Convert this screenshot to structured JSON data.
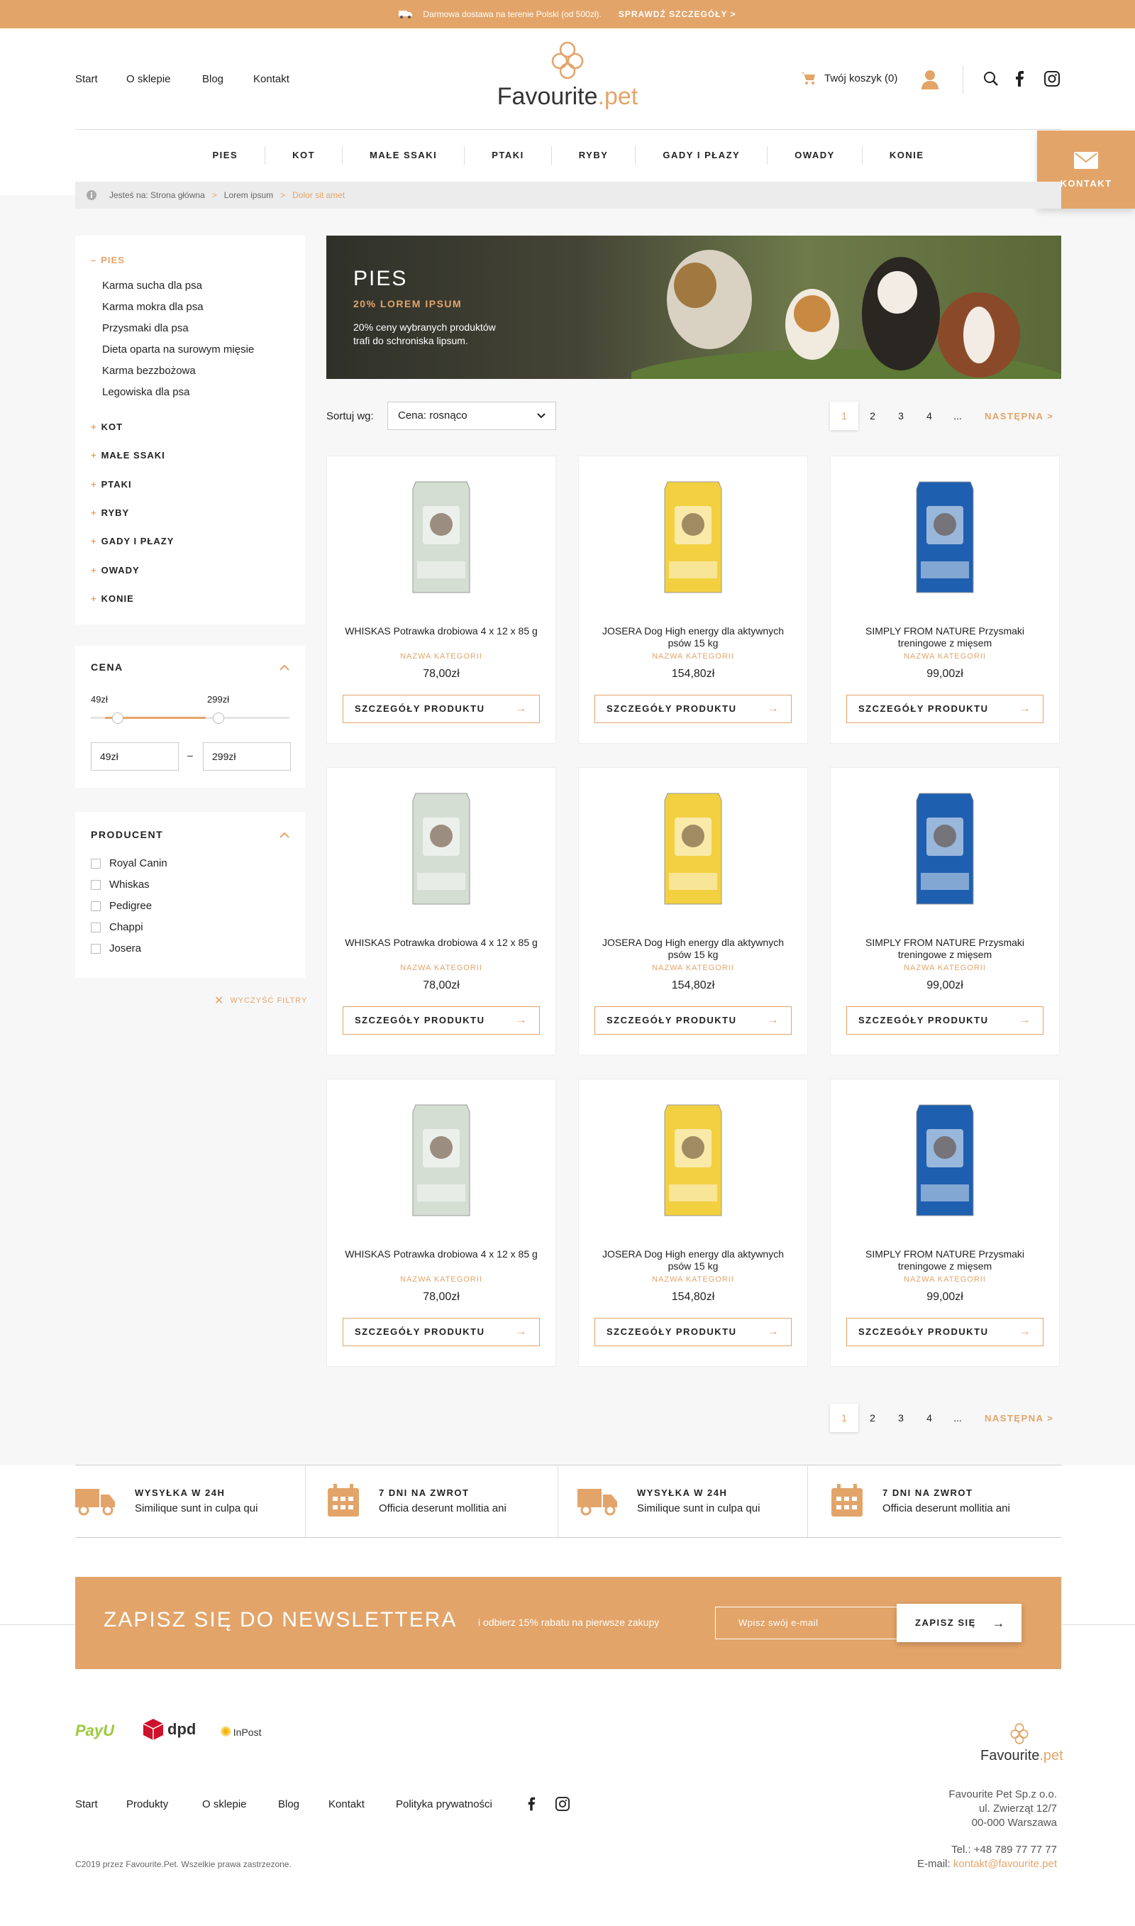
{
  "topbar": {
    "text": "Darmowa dostawa na terenie Polski (od 500zł).",
    "link": "SPRAWDŹ SZCZEGÓŁY >"
  },
  "header": {
    "nav": [
      "Start",
      "O sklepie",
      "Blog",
      "Kontakt"
    ],
    "logo_main": "Favourite",
    "logo_ext": ".pet",
    "cart": "Twój koszyk (0)",
    "contact": "KONTAKT"
  },
  "categories": [
    "PIES",
    "KOT",
    "MAŁE SSAKI",
    "PTAKI",
    "RYBY",
    "GADY I PŁAZY",
    "OWADY",
    "KONIE"
  ],
  "breadcrumb": {
    "prefix": "Jesteś na: Strona główna",
    "item1": "Lorem ipsum",
    "item2": "Dolor sit amet",
    "sep": ">"
  },
  "sidebar": {
    "active_cat": "PIES",
    "minus": "–",
    "plus": "+",
    "subcats": [
      "Karma sucha dla psa",
      "Karma mokra dla psa",
      "Przysmaki dla psa",
      "Dieta oparta na surowym mięsie",
      "Karma bezzbożowa",
      "Legowiska dla psa"
    ],
    "other_cats": [
      "KOT",
      "MAŁE SSAKI",
      "PTAKI",
      "RYBY",
      "GADY I PŁAZY",
      "OWADY",
      "KONIE"
    ],
    "price": {
      "title": "CENA",
      "min": "49zł",
      "max": "299zł",
      "min_input": "49zł",
      "max_input": "299zł",
      "dash": "–"
    },
    "producer": {
      "title": "PRODUCENT",
      "items": [
        "Royal Canin",
        "Whiskas",
        "Pedigree",
        "Chappi",
        "Josera"
      ]
    },
    "clear": "WYCZYŚĆ FILTRY"
  },
  "banner": {
    "title": "PIES",
    "subtitle": "20% LOREM IPSUM",
    "desc": "20% ceny wybranych produktów trafi do schroniska lipsum."
  },
  "sort": {
    "label": "Sortuj wg:",
    "value": "Cena: rosnąco"
  },
  "pagination": {
    "pages": [
      "1",
      "2",
      "3",
      "4",
      "..."
    ],
    "active": "1",
    "next": "NASTĘPNA >"
  },
  "products": [
    {
      "name": "WHISKAS Potrawka drobiowa 4 x 12 x 85 g",
      "category": "NAZWA KATEGORII",
      "price": "78,00zł",
      "button": "SZCZEGÓŁY PRODUKTU",
      "pack": "NATUREPLUS+",
      "pack_color": "#d4ded2"
    },
    {
      "name": "JOSERA Dog High energy dla aktywnych psów 15 kg",
      "category": "NAZWA KATEGORII",
      "price": "154,80zł",
      "button": "SZCZEGÓŁY PRODUKTU",
      "pack": "Josera",
      "pack_color": "#f2d040"
    },
    {
      "name": "SIMPLY FROM NATURE Przysmaki treningowe z mięsem",
      "category": "NAZWA KATEGORII",
      "price": "99,00zł",
      "button": "SZCZEGÓŁY PRODUKTU",
      "pack": "Chappi",
      "pack_color": "#1e5fb0"
    },
    {
      "name": "WHISKAS Potrawka drobiowa 4 x 12 x 85 g",
      "category": "NAZWA KATEGORII",
      "price": "78,00zł",
      "button": "SZCZEGÓŁY PRODUKTU",
      "pack": "NATUREPLUS+",
      "pack_color": "#d4ded2"
    },
    {
      "name": "JOSERA Dog High energy dla aktywnych psów 15 kg",
      "category": "NAZWA KATEGORII",
      "price": "154,80zł",
      "button": "SZCZEGÓŁY PRODUKTU",
      "pack": "Josera",
      "pack_color": "#f2d040"
    },
    {
      "name": "SIMPLY FROM NATURE Przysmaki treningowe z mięsem",
      "category": "NAZWA KATEGORII",
      "price": "99,00zł",
      "button": "SZCZEGÓŁY PRODUKTU",
      "pack": "Chappi",
      "pack_color": "#1e5fb0"
    },
    {
      "name": "WHISKAS Potrawka drobiowa 4 x 12 x 85 g",
      "category": "NAZWA KATEGORII",
      "price": "78,00zł",
      "button": "SZCZEGÓŁY PRODUKTU",
      "pack": "NATUREPLUS+",
      "pack_color": "#d4ded2"
    },
    {
      "name": "JOSERA Dog High energy dla aktywnych psów 15 kg",
      "category": "NAZWA KATEGORII",
      "price": "154,80zł",
      "button": "SZCZEGÓŁY PRODUKTU",
      "pack": "Josera",
      "pack_color": "#f2d040"
    },
    {
      "name": "SIMPLY FROM NATURE Przysmaki treningowe z mięsem",
      "category": "NAZWA KATEGORII",
      "price": "99,00zł",
      "button": "SZCZEGÓŁY PRODUKTU",
      "pack": "Chappi",
      "pack_color": "#1e5fb0"
    }
  ],
  "features": [
    {
      "icon": "truck-icon",
      "title": "WYSYŁKA W 24H",
      "text": "Similique sunt in culpa qui"
    },
    {
      "icon": "calendar-icon",
      "title": "7 DNI NA ZWROT",
      "text": "Officia deserunt mollitia ani"
    },
    {
      "icon": "truck-icon",
      "title": "WYSYŁKA W 24H",
      "text": "Similique sunt in culpa qui"
    },
    {
      "icon": "calendar-icon",
      "title": "7 DNI NA ZWROT",
      "text": "Officia deserunt mollitia ani"
    }
  ],
  "newsletter": {
    "title": "ZAPISZ SIĘ DO NEWSLETTERA",
    "subtitle": "i odbierz 15% rabatu na pierwsze zakupy",
    "placeholder": "Wpisz swój e-mail",
    "button": "ZAPISZ SIĘ"
  },
  "footer": {
    "payments": [
      "PayU",
      "dpd",
      "InPost"
    ],
    "links": [
      "Start",
      "Produkty",
      "O sklepie",
      "Blog",
      "Kontakt",
      "Polityka prywatności"
    ],
    "logo_main": "Favourite",
    "logo_ext": ".pet",
    "company": "Favourite Pet Sp.z o.o.",
    "street": "ul. Zwierząt 12/7",
    "city": "00-000 Warszawa",
    "tel_label": "Tel.:",
    "tel": "+48 789 77 77 77",
    "email_label": "E-mail:",
    "email": "kontakt@favourite.pet",
    "copyright": "C2019 przez Favourite.Pet. Wszelkie prawa zastrzezone."
  },
  "colors": {
    "accent": "#e3a469",
    "light_gray": "#f7f7f7"
  }
}
